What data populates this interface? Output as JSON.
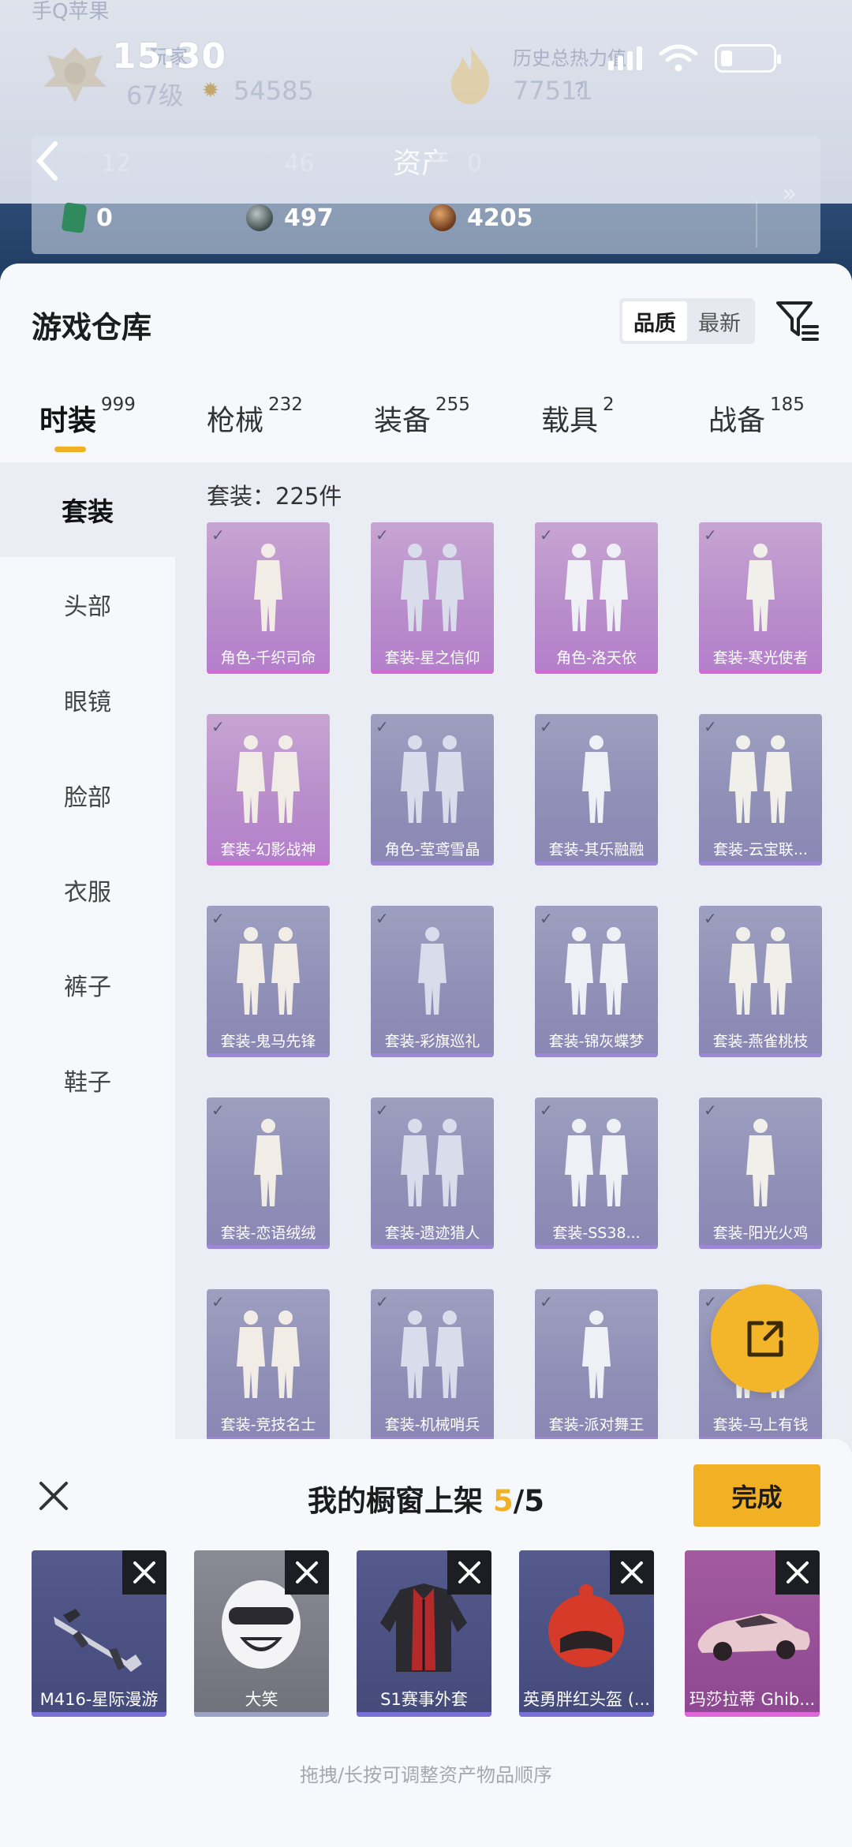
{
  "status": {
    "time": "15:30"
  },
  "header_ghost": {
    "top_label": "手Q苹果",
    "player_label": "玩家",
    "level": "67级",
    "coins": "54585",
    "heat_label": "历史总热力值",
    "heat_value": "77511",
    "heat_help": "?"
  },
  "assets": {
    "title": "资产",
    "row_ghost": [
      {
        "icon": "card-icon",
        "value": "12"
      },
      {
        "icon": "coin-icon",
        "value": "46"
      },
      {
        "icon": "token-icon",
        "value": "0"
      }
    ],
    "row": [
      {
        "icon": "green-card-icon",
        "value": "0"
      },
      {
        "icon": "silver-orb-icon",
        "value": "497"
      },
      {
        "icon": "bronze-orb-icon",
        "value": "4205"
      }
    ]
  },
  "warehouse": {
    "title": "游戏仓库",
    "sort": {
      "options": [
        "品质",
        "最新"
      ],
      "active": "品质"
    }
  },
  "tabs": [
    {
      "label": "时装",
      "count": "999",
      "active": true
    },
    {
      "label": "枪械",
      "count": "232"
    },
    {
      "label": "装备",
      "count": "255"
    },
    {
      "label": "载具",
      "count": "2"
    },
    {
      "label": "战备",
      "count": "185"
    }
  ],
  "sidebar": [
    "套装",
    "头部",
    "眼镜",
    "脸部",
    "衣服",
    "裤子",
    "鞋子"
  ],
  "count_line": "套装：225件",
  "items": [
    {
      "name": "角色-千织司命",
      "rarity": "pink"
    },
    {
      "name": "套装-星之信仰",
      "rarity": "pink"
    },
    {
      "name": "角色-洛天依",
      "rarity": "pink"
    },
    {
      "name": "套装-寒光使者",
      "rarity": "pink"
    },
    {
      "name": "套装-幻影战神",
      "rarity": "pink"
    },
    {
      "name": "角色-莹鸢雪晶",
      "rarity": "purple"
    },
    {
      "name": "套装-其乐融融",
      "rarity": "purple"
    },
    {
      "name": "套装-云宝联...",
      "rarity": "purple"
    },
    {
      "name": "套装-鬼马先锋",
      "rarity": "purple"
    },
    {
      "name": "套装-彩旗巡礼",
      "rarity": "purple"
    },
    {
      "name": "套装-锦灰蝶梦",
      "rarity": "purple"
    },
    {
      "name": "套装-燕雀桃枝",
      "rarity": "purple"
    },
    {
      "name": "套装-恋语绒绒",
      "rarity": "purple"
    },
    {
      "name": "套装-遗迹猎人",
      "rarity": "purple"
    },
    {
      "name": "套装-SS38...",
      "rarity": "purple"
    },
    {
      "name": "套装-阳光火鸡",
      "rarity": "purple"
    },
    {
      "name": "套装-竞技名士",
      "rarity": "purple"
    },
    {
      "name": "套装-机械哨兵",
      "rarity": "purple"
    },
    {
      "name": "套装-派对舞王",
      "rarity": "purple"
    },
    {
      "name": "套装-马上有钱",
      "rarity": "purple"
    }
  ],
  "showcase": {
    "title_prefix": "我的橱窗上架 ",
    "current": "5",
    "separator": "/",
    "max": "5",
    "done_label": "完成",
    "slots": [
      {
        "name": "M416-星际漫游",
        "icon": "rifle-icon"
      },
      {
        "name": "大笑",
        "icon": "laughing-helmet-icon"
      },
      {
        "name": "S1赛事外套",
        "icon": "jacket-icon"
      },
      {
        "name": "英勇胖红头盔 (...",
        "icon": "red-helmet-icon"
      },
      {
        "name": "玛莎拉蒂 Ghib...",
        "icon": "car-icon"
      }
    ],
    "hint": "拖拽/长按可调整资产物品顺序"
  }
}
